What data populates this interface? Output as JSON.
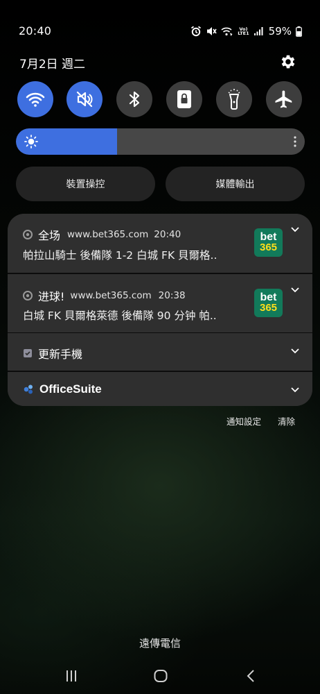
{
  "status_bar": {
    "time": "20:40",
    "volte_line1": "Vo)",
    "volte_line2": "LTE1",
    "battery": "59%",
    "icons": [
      "alarm-icon",
      "mute-icon",
      "wifi-calling-icon",
      "volte-icon",
      "signal-icon",
      "battery-icon"
    ]
  },
  "header": {
    "date": "7月2日 週二",
    "settings_icon": "gear-icon"
  },
  "quick_settings": {
    "toggles": [
      {
        "name": "wifi",
        "icon": "wifi-icon",
        "on": true
      },
      {
        "name": "sound",
        "icon": "mute-icon",
        "on": true
      },
      {
        "name": "bluetooth",
        "icon": "bluetooth-icon",
        "on": false
      },
      {
        "name": "screen-lock",
        "icon": "lock-icon",
        "on": false
      },
      {
        "name": "flashlight",
        "icon": "flashlight-icon",
        "on": false
      },
      {
        "name": "airplane",
        "icon": "airplane-icon",
        "on": false
      }
    ],
    "brightness_level": 0.35,
    "device_control": "裝置操控",
    "media_output": "媒體輸出"
  },
  "notifications": [
    {
      "app_icon": "chrome-icon",
      "title": "全场",
      "site": "www.bet365.com",
      "time": "20:40",
      "body": "帕拉山騎士 後備隊 1-2 白城 FK 貝爾格..",
      "logo_top": "bet",
      "logo_bottom": "365"
    },
    {
      "app_icon": "chrome-icon",
      "title": "进球!",
      "site": "www.bet365.com",
      "time": "20:38",
      "body": "白城 FK 貝爾格萊德 後備隊 90 分钟 帕..",
      "logo_top": "bet",
      "logo_bottom": "365"
    },
    {
      "app_icon": "update-icon",
      "title": "更新手機"
    },
    {
      "app_icon": "officesuite-icon",
      "title": "OfficeSuite"
    }
  ],
  "notification_actions": {
    "settings": "通知設定",
    "clear": "清除"
  },
  "carrier": "遠傳電信",
  "colors": {
    "accent": "#3e6fe0",
    "card": "#2f2f2f",
    "bet365_green": "#127a5a",
    "bet365_yellow": "#ffdf1b"
  }
}
